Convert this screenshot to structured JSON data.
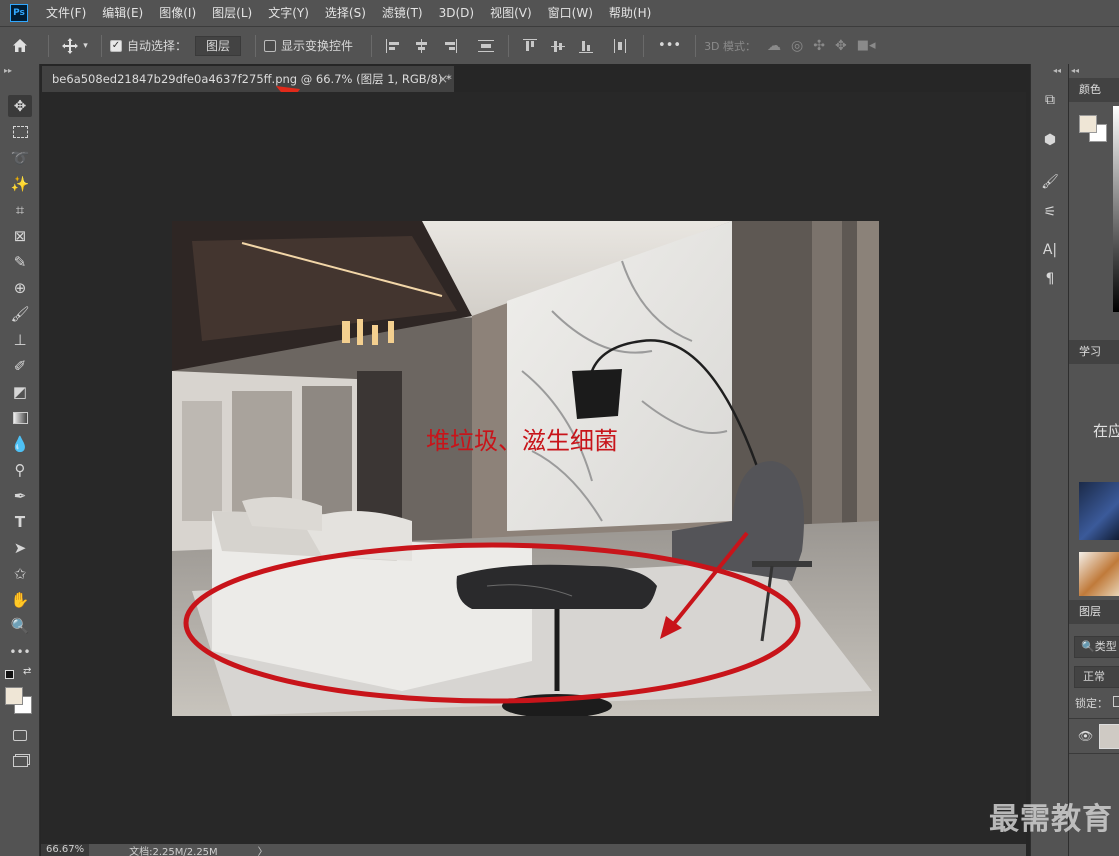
{
  "app": {
    "logo": "Ps"
  },
  "menu": [
    "文件(F)",
    "编辑(E)",
    "图像(I)",
    "图层(L)",
    "文字(Y)",
    "选择(S)",
    "滤镜(T)",
    "3D(D)",
    "视图(V)",
    "窗口(W)",
    "帮助(H)"
  ],
  "options": {
    "auto_select_label": "自动选择：",
    "auto_select_target": "图层",
    "show_transform_label": "显示变换控件",
    "mode_3d_label": "3D 模式：",
    "more_label": "•••"
  },
  "document": {
    "tab_title": "be6a508ed21847b29dfe0a4637f275ff.png @ 66.7% (图层 1, RGB/8) *",
    "close_symbol": "×",
    "annotation_text": "堆垃圾、滋生细菌"
  },
  "status": {
    "zoom": "66.67%",
    "doc_size": "文档:2.25M/2.25M",
    "arrow": "〉"
  },
  "panels": {
    "color_tab": "颜色",
    "learn_tab": "学习",
    "learn_text": "在应",
    "layers_tab": "图层",
    "layers_search": "类型",
    "blend_mode": "正常",
    "lock_label": "锁定："
  },
  "watermark": "最需教育",
  "colors": {
    "annotation_red": "#c8141a",
    "foreground_swatch": "#efe6d6",
    "background_swatch": "#ffffff",
    "ui_panel": "#535353",
    "ui_canvas": "#282828"
  }
}
